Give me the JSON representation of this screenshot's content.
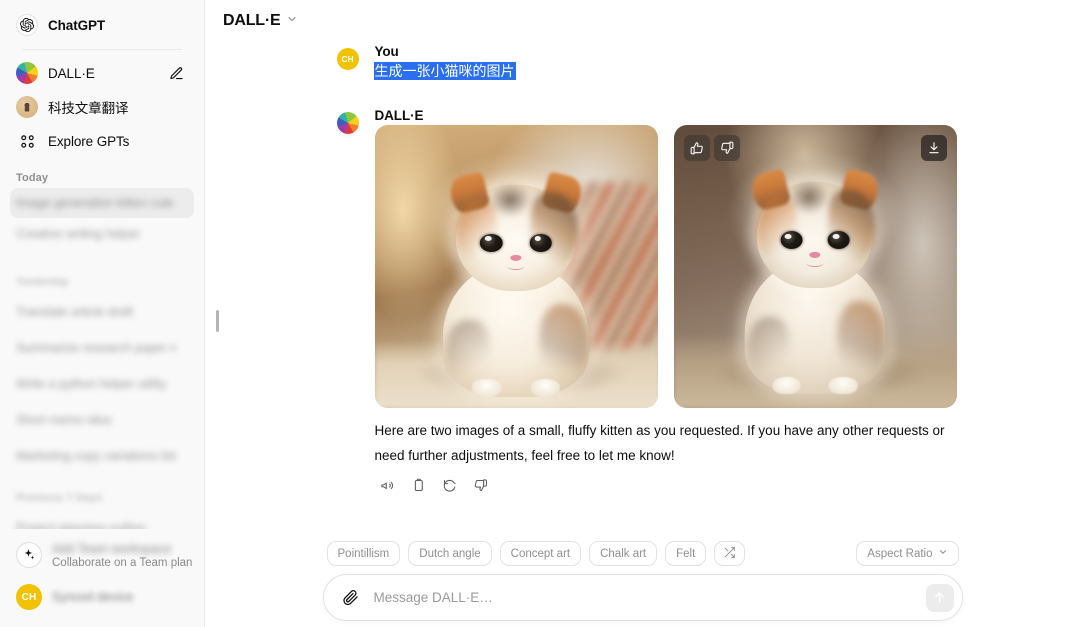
{
  "sidebar": {
    "top_items": [
      {
        "label": "ChatGPT",
        "icon": "openai-logo-icon",
        "bold": true
      },
      {
        "label": "DALL·E",
        "icon": "dalle-logo-icon",
        "bold": false,
        "trailing_icon": "new-chat-edit-icon"
      },
      {
        "label": "科技文章翻译",
        "icon": "gpt-avatar-icon",
        "bold": false
      },
      {
        "label": "Explore GPTs",
        "icon": "grid-apps-icon",
        "bold": false
      }
    ],
    "groups": [
      {
        "title": "Today",
        "title_redacted": false,
        "items": [
          {
            "label": "",
            "redacted": true,
            "width": "wide",
            "active": true
          },
          {
            "label": "",
            "redacted": true,
            "width": "mid",
            "active": false
          }
        ]
      },
      {
        "title": "Yesterday",
        "title_redacted": true,
        "items": [
          {
            "label": "",
            "redacted": true,
            "width": "mid",
            "active": false
          },
          {
            "label": "",
            "redacted": true,
            "width": "wide",
            "active": false
          },
          {
            "label": "",
            "redacted": true,
            "width": "wide",
            "active": false
          },
          {
            "label": "",
            "redacted": true,
            "width": "short",
            "active": false
          },
          {
            "label": "",
            "redacted": true,
            "width": "wide",
            "active": false
          }
        ]
      },
      {
        "title": "Previous 7 Days",
        "title_redacted": true,
        "items": [
          {
            "label": "",
            "redacted": true,
            "width": "mid",
            "active": false
          },
          {
            "label": "",
            "redacted": true,
            "width": "wide",
            "active": false
          }
        ]
      }
    ],
    "upgrade": {
      "title": "Add Team workspace",
      "subtitle": "Collaborate on a Team plan",
      "icon": "sparkle-icon"
    },
    "user": {
      "initials": "CH",
      "name": "Synced device"
    }
  },
  "header": {
    "model_name": "DALL·E",
    "chevron": "chevron-down-icon"
  },
  "conversation": {
    "user_message": {
      "author": "You",
      "avatar_initials": "CH",
      "text": "生成一张小猫咪的图片",
      "selected": true,
      "selection_color": "#2a6ff0"
    },
    "assistant_message": {
      "author": "DALL·E",
      "avatar": "dalle-logo-icon",
      "images": [
        {
          "alt": "Fluffy calico kitten sitting on cream carpet in warm light",
          "has_overlay_buttons": false
        },
        {
          "alt": "Fluffy calico kitten sitting on carpet in soft beige light",
          "has_overlay_buttons": true,
          "overlay_buttons": [
            {
              "name": "thumbs-up-icon",
              "label": "Good response"
            },
            {
              "name": "thumbs-down-icon",
              "label": "Bad response"
            },
            {
              "name": "download-icon",
              "label": "Download"
            }
          ]
        }
      ],
      "text": "Here are two images of a small, fluffy kitten as you requested. If you have any other requests or need further adjustments, feel free to let me know!",
      "actions": [
        {
          "name": "read-aloud-icon",
          "label": "Read aloud"
        },
        {
          "name": "copy-icon",
          "label": "Copy"
        },
        {
          "name": "regenerate-icon",
          "label": "Regenerate"
        },
        {
          "name": "thumbs-down-icon",
          "label": "Bad response"
        }
      ]
    }
  },
  "suggestions": {
    "chips": [
      {
        "label": "Pointillism",
        "icon": null
      },
      {
        "label": "Dutch angle",
        "icon": null
      },
      {
        "label": "Concept art",
        "icon": null
      },
      {
        "label": "Chalk art",
        "icon": null
      },
      {
        "label": "Felt",
        "icon": null
      },
      {
        "label": "",
        "icon": "shuffle-icon"
      }
    ],
    "aspect_ratio": {
      "label": "Aspect Ratio",
      "chevron": "chevron-down-icon"
    }
  },
  "composer": {
    "attach_icon": "paperclip-icon",
    "placeholder": "Message DALL·E…",
    "value": "",
    "send_icon": "arrow-up-icon",
    "send_disabled": true
  },
  "colors": {
    "accent_selection": "#2a6ff0",
    "avatar_yellow": "#f2c100",
    "sidebar_bg": "#f9f9f9",
    "border": "#ececec"
  }
}
